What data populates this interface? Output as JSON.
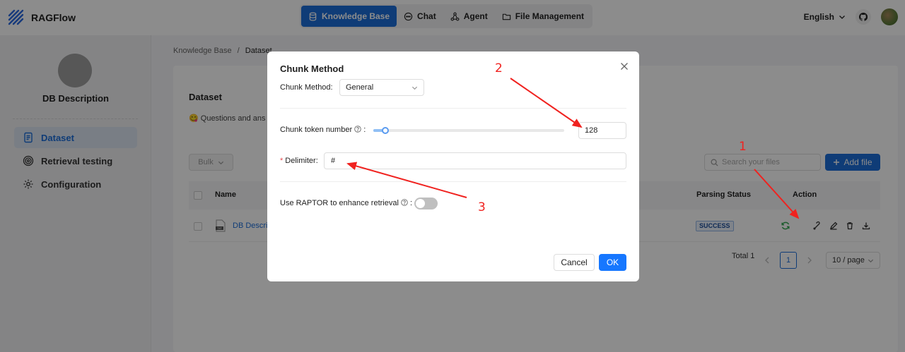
{
  "app": {
    "name": "RAGFlow"
  },
  "nav": {
    "items": [
      {
        "label": "Knowledge Base",
        "icon": "database-icon"
      },
      {
        "label": "Chat",
        "icon": "chat-bubble-icon"
      },
      {
        "label": "Agent",
        "icon": "agent-graph-icon"
      },
      {
        "label": "File Management",
        "icon": "folder-icon"
      }
    ]
  },
  "header_right": {
    "language": "English"
  },
  "sidebar": {
    "kb_name": "DB Description",
    "items": [
      {
        "label": "Dataset",
        "icon": "document-icon"
      },
      {
        "label": "Retrieval testing",
        "icon": "target-icon"
      },
      {
        "label": "Configuration",
        "icon": "gear-icon"
      }
    ]
  },
  "breadcrumb": {
    "parent": "Knowledge Base",
    "separator": "/",
    "current": "Dataset"
  },
  "dataset": {
    "title": "Dataset",
    "description": "Questions and ans",
    "description_emoji": "😋",
    "bulk_label": "Bulk",
    "search_placeholder": "Search your files",
    "add_file_label": "Add file",
    "columns": {
      "name": "Name",
      "parsing_status": "Parsing Status",
      "action": "Action"
    },
    "rows": [
      {
        "name": "DB Descri",
        "status": "SUCCESS"
      }
    ],
    "pagination": {
      "total": "Total 1",
      "page": "1",
      "page_size": "10 / page"
    }
  },
  "modal": {
    "title": "Chunk Method",
    "chunk_method_label": "Chunk Method",
    "chunk_method_value": "General",
    "token_label": "Chunk token number",
    "token_value": "128",
    "token_slider_level": 0.065,
    "delimiter_label": "Delimiter",
    "delimiter_value": "#",
    "raptor_label": "Use RAPTOR to enhance retrieval",
    "raptor_enabled": false,
    "cancel_label": "Cancel",
    "ok_label": "OK"
  },
  "annotations": [
    "1",
    "2",
    "3"
  ],
  "colors": {
    "primary": "#1c6ed9",
    "annotation": "#f0221f",
    "ok_button": "#1677ff"
  }
}
